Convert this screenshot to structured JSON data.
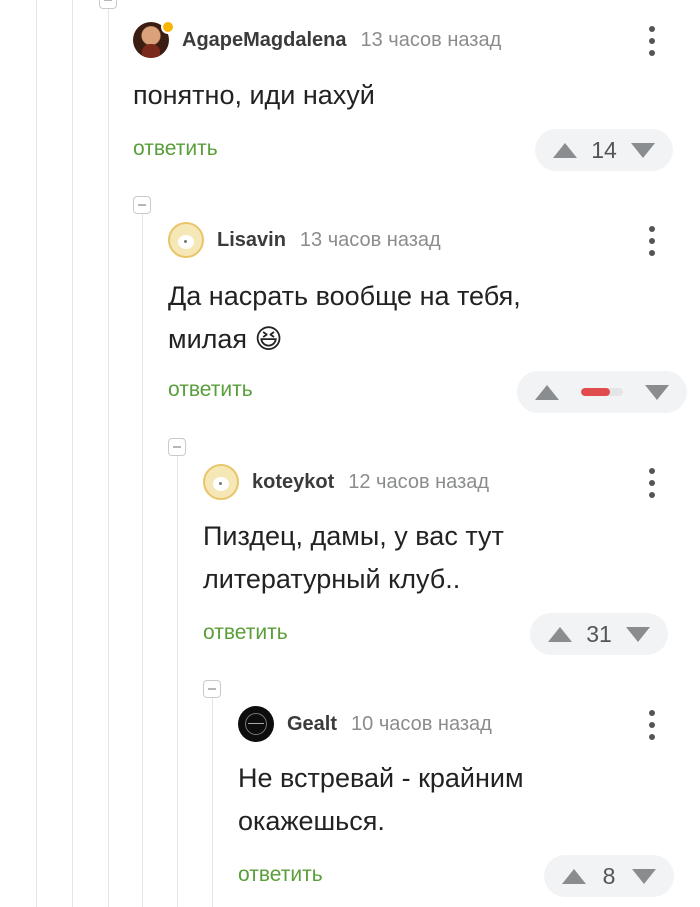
{
  "comments": [
    {
      "username": "AgapeMagdalena",
      "time": "13 часов назад",
      "lines": [
        "понятно, иди нахуй"
      ],
      "reply_label": "ответить",
      "score": "14",
      "avatar_icon": "woman-portrait-avatar"
    },
    {
      "username": "Lisavin",
      "time": "13 часов назад",
      "lines": [
        "Да насрать вообще на тебя,",
        "милая 😆"
      ],
      "reply_label": "ответить",
      "score_bar": {
        "negative_fraction": 0.7,
        "color": "#e14c4c"
      },
      "avatar_icon": "default-cat-avatar"
    },
    {
      "username": "koteykot",
      "time": "12 часов назад",
      "lines": [
        "Пиздец, дамы, у вас тут",
        "литературный клуб.."
      ],
      "reply_label": "ответить",
      "score": "31",
      "avatar_icon": "default-cat-avatar"
    },
    {
      "username": "Gealt",
      "time": "10 часов назад",
      "lines": [
        "Не встревай - крайним",
        "окажешься."
      ],
      "reply_label": "ответить",
      "score": "8",
      "avatar_icon": "dark-logo-avatar"
    }
  ],
  "colors": {
    "reply": "#5a9e3a",
    "online_indicator": "#f7b500",
    "thread_line": "#e2e4e6"
  }
}
